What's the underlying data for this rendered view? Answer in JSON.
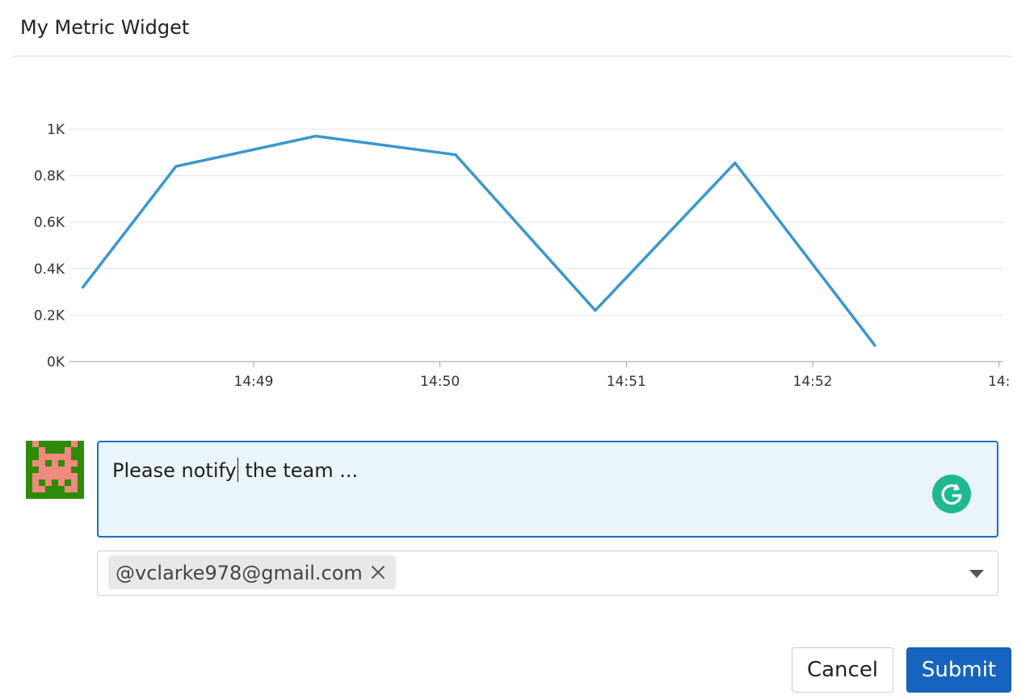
{
  "widget": {
    "title": "My Metric Widget"
  },
  "chart_data": {
    "type": "line",
    "x_ticks": [
      "14:49",
      "14:50",
      "14:51",
      "14:52",
      "14:"
    ],
    "y_ticks": [
      "0K",
      "0.2K",
      "0.4K",
      "0.6K",
      "0.8K",
      "1K"
    ],
    "ylim": [
      0,
      1000
    ],
    "grid": true,
    "line_color": "#3a97cf",
    "series": [
      {
        "x": [
          "14:48:05",
          "14:48:35",
          "14:49:20",
          "14:50:05",
          "14:50:50",
          "14:51:35",
          "14:52:20"
        ],
        "values": [
          320,
          840,
          970,
          890,
          220,
          855,
          70
        ]
      }
    ]
  },
  "comment": {
    "text_before_caret": "Please notify",
    "text_after_caret": " the team ...",
    "background_color": "#eaf4fb",
    "border_color": "#1b6fc6"
  },
  "grammarly": {
    "icon": "grammarly-icon",
    "color": "#1fb891"
  },
  "avatar": {
    "icon": "pixel-invader-avatar",
    "background_color": "#2e8b0a",
    "pixel_color": "#f08a80"
  },
  "recipients": {
    "tags": [
      {
        "label": "@vclarke978@gmail.com"
      }
    ],
    "dropdown_icon": "caret-down-icon"
  },
  "buttons": {
    "cancel_label": "Cancel",
    "submit_label": "Submit",
    "submit_color": "#1664c0"
  }
}
